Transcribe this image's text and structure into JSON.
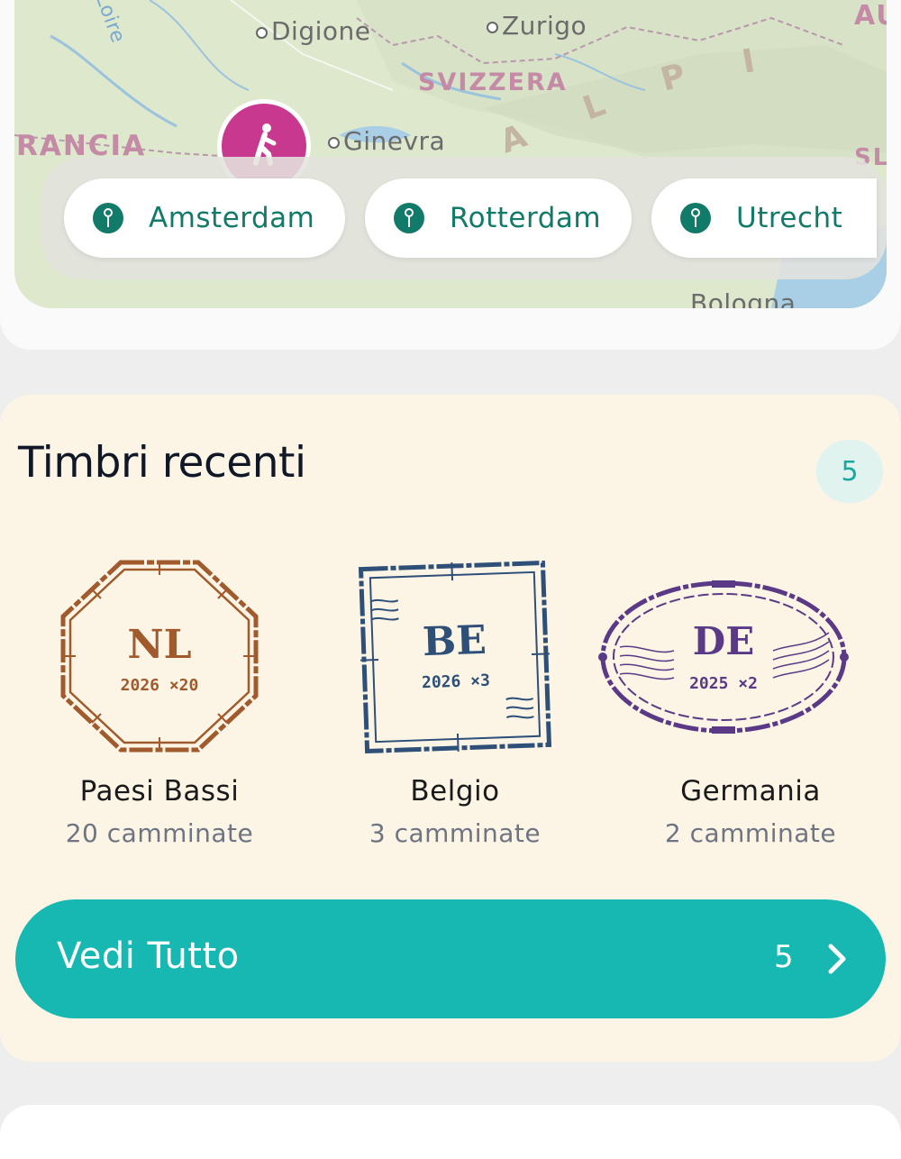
{
  "map": {
    "labels": {
      "loire": "Loire",
      "digione": "Digione",
      "zurigo": "Zurigo",
      "au": "AU",
      "svizzera": "SVIZZERA",
      "francia": "RANCIA",
      "ginevra": "Ginevra",
      "sl": "SL",
      "bologna": "Bologna",
      "alpi": [
        "A",
        "L",
        "P",
        "I"
      ]
    },
    "chips": [
      {
        "label": "Amsterdam"
      },
      {
        "label": "Rotterdam"
      },
      {
        "label": "Utrecht"
      }
    ]
  },
  "stamps_section": {
    "title": "Timbri recenti",
    "count": "5",
    "stamps": [
      {
        "code": "NL",
        "meta": "2026  ×20",
        "name": "Paesi Bassi",
        "walks": "20 camminate",
        "color": "#a05a2c"
      },
      {
        "code": "BE",
        "meta": "2026  ×3",
        "name": "Belgio",
        "walks": "3 camminate",
        "color": "#2e4f77"
      },
      {
        "code": "DE",
        "meta": "2025  ×2",
        "name": "Germania",
        "walks": "2 camminate",
        "color": "#5a3a86"
      }
    ],
    "see_all": {
      "label": "Vedi Tutto",
      "count": "5"
    }
  },
  "colors": {
    "accent": "#18b8b2",
    "pin": "#117a68",
    "walker": "#c8388f"
  }
}
